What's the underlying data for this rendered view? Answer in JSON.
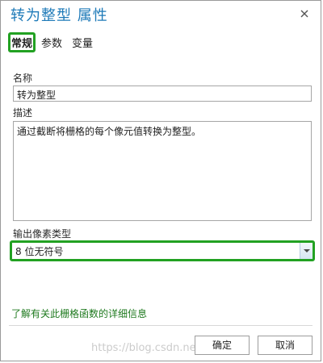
{
  "window": {
    "title": "转为整型 属性"
  },
  "tabs": [
    {
      "label": "常规",
      "active": true
    },
    {
      "label": "参数",
      "active": false
    },
    {
      "label": "变量",
      "active": false
    }
  ],
  "fields": {
    "name_label": "名称",
    "name_value": "转为整型",
    "description_label": "描述",
    "description_value": "通过截断将栅格的每个像元值转换为整型。",
    "output_type_label": "输出像素类型",
    "output_type_value": "8 位无符号"
  },
  "links": {
    "help": "了解有关此栅格函数的详细信息"
  },
  "buttons": {
    "ok": "确定",
    "cancel": "取消"
  },
  "watermark": "https://blog.csdn.net/...",
  "colors": {
    "title": "#1e7ab8",
    "highlight": "#22a122",
    "link": "#1f7a1f"
  }
}
